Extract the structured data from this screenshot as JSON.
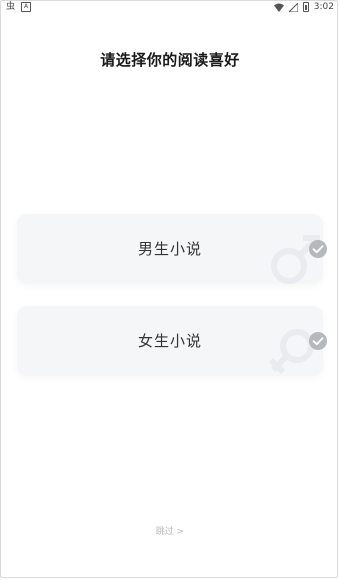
{
  "status_bar": {
    "left_icons": [
      "bug-icon",
      "a-icon"
    ],
    "bug_glyph": "虫",
    "a_glyph": "A",
    "time": "3:02"
  },
  "page": {
    "title": "请选择你的阅读喜好"
  },
  "options": [
    {
      "label": "男生小说",
      "icon": "male-symbol-icon",
      "checked": true
    },
    {
      "label": "女生小说",
      "icon": "female-symbol-icon",
      "checked": true
    }
  ],
  "skip": {
    "label": "跳过 >"
  },
  "colors": {
    "card_bg": "#f5f6f8",
    "check_bg": "#b5b8bd",
    "symbol": "#e9ebef",
    "skip_text": "#b9b9b9"
  }
}
